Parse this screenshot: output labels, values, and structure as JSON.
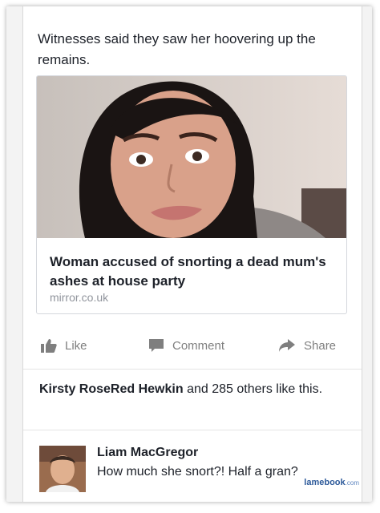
{
  "post": {
    "text": "Witnesses said they saw her hoovering up the remains."
  },
  "link_preview": {
    "title": "Woman accused of snorting a dead mum's ashes at house party",
    "domain": "mirror.co.uk"
  },
  "actions": {
    "like": "Like",
    "comment": "Comment",
    "share": "Share"
  },
  "likes": {
    "name": "Kirsty RoseRed Hewkin",
    "rest": "and 285 others like this."
  },
  "comment": {
    "author": "Liam MacGregor",
    "text": "How much she snort?! Half a gran?"
  },
  "watermark": {
    "brand": "lamebook",
    "suffix": ".com"
  },
  "colors": {
    "text": "#1d2129",
    "muted": "#7f7f7f",
    "domain": "#90949c"
  }
}
